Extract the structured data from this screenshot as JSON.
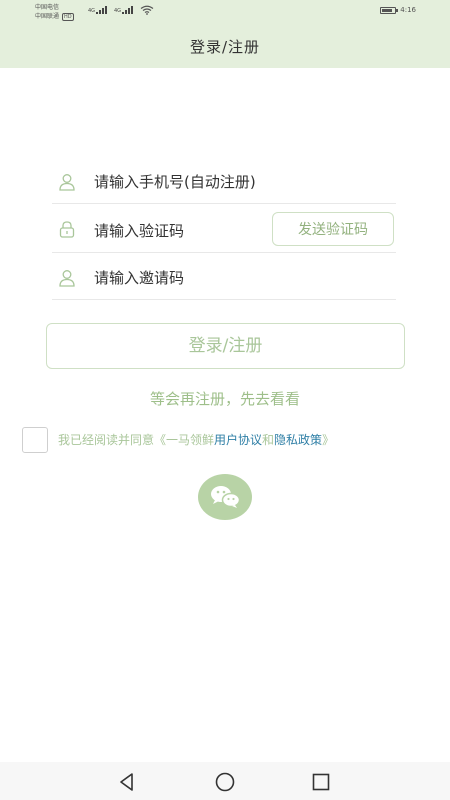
{
  "status_bar": {
    "carrier_1": "中国电信",
    "carrier_2": "中国联通",
    "hd_badge": "HD",
    "network_1": "4G",
    "network_2": "4G",
    "time": "4:16"
  },
  "header": {
    "title": "登录/注册"
  },
  "form": {
    "phone_placeholder": "请输入手机号(自动注册)",
    "code_placeholder": "请输入验证码",
    "send_code_label": "发送验证码",
    "invite_placeholder": "请输入邀请码"
  },
  "login_button_label": "登录/注册",
  "later_link": "等会再注册，先去看看",
  "agreement": {
    "prefix": "我已经阅读并同意《一马领鲜",
    "user_agreement": "用户协议",
    "and": "和",
    "privacy_policy": "隐私政策",
    "suffix": "》",
    "checked": false
  },
  "icons": {
    "phone_field": "user-icon",
    "code_field": "lock-icon",
    "invite_field": "user-icon",
    "wechat": "wechat-icon",
    "nav_back": "back-triangle-icon",
    "nav_home": "home-circle-icon",
    "nav_recents": "recents-square-icon"
  },
  "colors": {
    "header_bg": "#e4efdc",
    "accent_green": "#a9c69a",
    "link_blue": "#2f7fa6",
    "wechat_bg": "#b8d3a6"
  }
}
